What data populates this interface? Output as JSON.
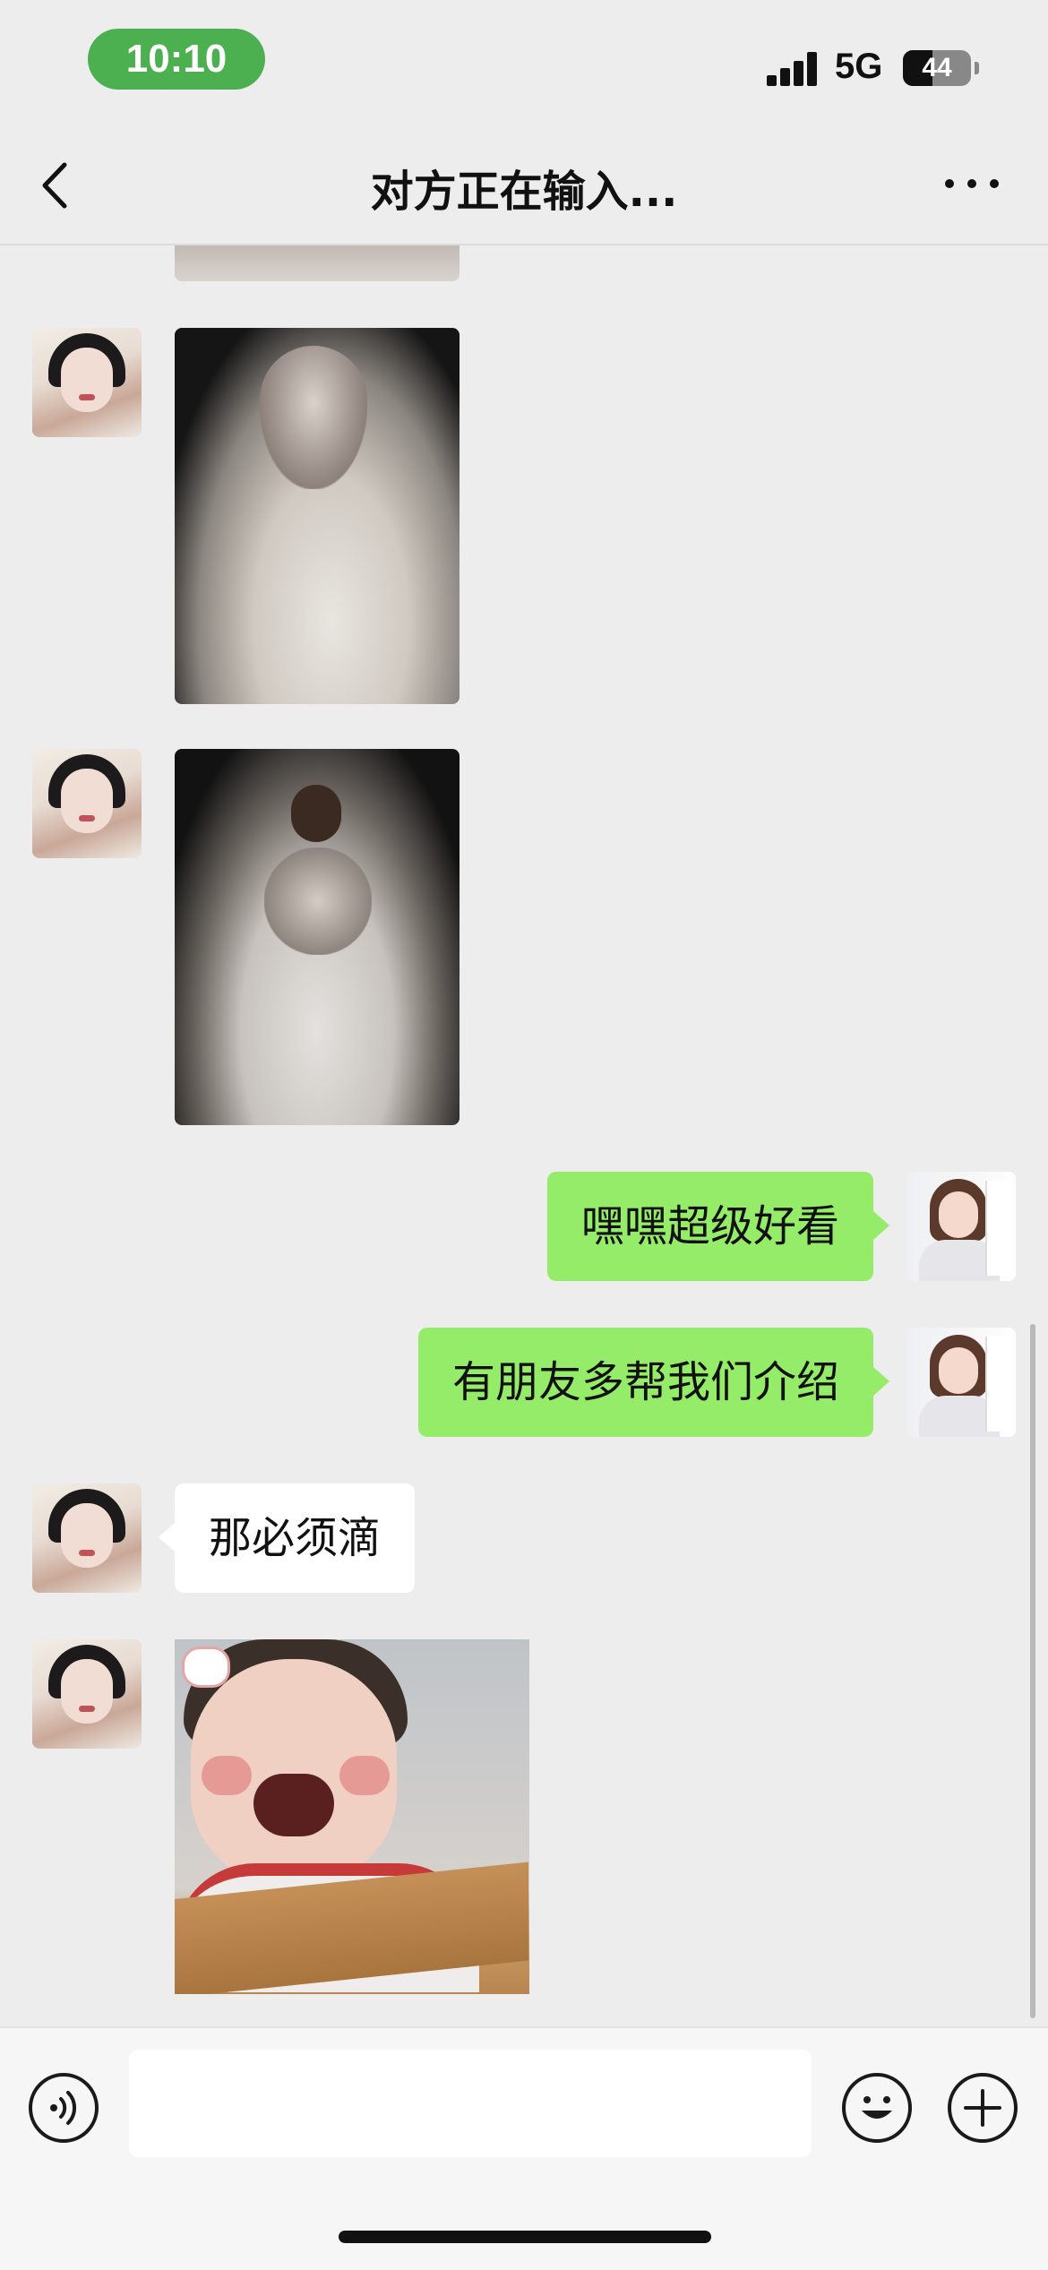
{
  "status_bar": {
    "time": "10:10",
    "network": "5G",
    "battery": "44"
  },
  "nav": {
    "title": "对方正在输入..."
  },
  "messages": [
    {
      "type": "image",
      "side": "left",
      "content": "wedding-dress-photo-partial"
    },
    {
      "type": "image",
      "side": "left",
      "content": "wedding-dress-back-photo"
    },
    {
      "type": "image",
      "side": "left",
      "content": "wedding-dress-seated-photo"
    },
    {
      "type": "text",
      "side": "right",
      "text": "嘿嘿超级好看"
    },
    {
      "type": "text",
      "side": "right",
      "text": "有朋友多帮我们介绍"
    },
    {
      "type": "text",
      "side": "left",
      "text": "那必须滴"
    },
    {
      "type": "image",
      "side": "left",
      "content": "baby-laughing-sticker"
    }
  ],
  "icons": {
    "back": "chevron-left-icon",
    "more": "more-dots-icon",
    "voice": "voice-icon",
    "emoji": "emoji-icon",
    "plus": "plus-icon"
  },
  "colors": {
    "outgoing_bubble": "#95ec69",
    "incoming_bubble": "#ffffff",
    "background": "#ededed",
    "time_pill": "#4caf50"
  }
}
